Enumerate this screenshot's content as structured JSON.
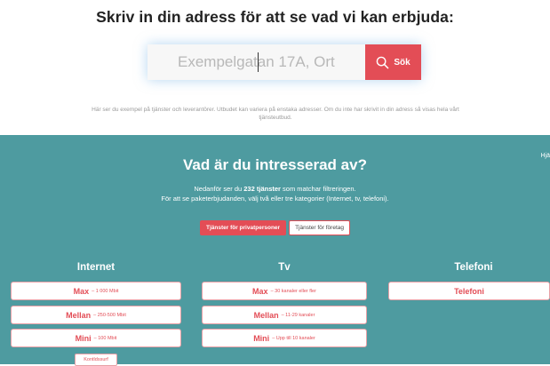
{
  "header": {
    "headline": "Skriv in din adress för att se vad vi kan erbjuda:"
  },
  "search": {
    "placeholder": "Exempelgatan 17A, Ort",
    "button_label": "Sök",
    "button_icon": "search-icon"
  },
  "info_text": "Här ser du exempel på tjänster och leverantörer. Utbudet kan variera på enstaka adresser. Om du inte har skrivit in din adress så visas hela vårt tjänsteutbud.",
  "interests": {
    "help_label": "Hjä",
    "title": "Vad är du intresserad av?",
    "desc_before": "Nedanför ser du ",
    "desc_count": "232 tjänster",
    "desc_after": " som matchar filtreringen.",
    "desc_line2": "För att se paketerbjudanden, välj två eller tre kategorier (Internet, tv, telefoni).",
    "toggles": [
      {
        "label": "Tjänster för privatpersoner",
        "active": true
      },
      {
        "label": "Tjänster för företag",
        "active": false
      }
    ]
  },
  "categories": [
    {
      "title": "Internet",
      "options": [
        {
          "name": "Max",
          "sub": "– 1 000 Mbit"
        },
        {
          "name": "Mellan",
          "sub": "– 250-500 Mbit"
        },
        {
          "name": "Mini",
          "sub": "– 100 Mbit"
        }
      ],
      "extra_button": "Kontldssurf"
    },
    {
      "title": "Tv",
      "options": [
        {
          "name": "Max",
          "sub": "– 30 kanaler eller fler"
        },
        {
          "name": "Mellan",
          "sub": "– 11-29 kanaler"
        },
        {
          "name": "Mini",
          "sub": "– Upp till 10 kanaler"
        }
      ]
    },
    {
      "title": "Telefoni",
      "options": [
        {
          "name": "Telefoni",
          "sub": ""
        }
      ]
    }
  ],
  "colors": {
    "accent": "#e34d56",
    "teal": "#4e9ba0"
  }
}
